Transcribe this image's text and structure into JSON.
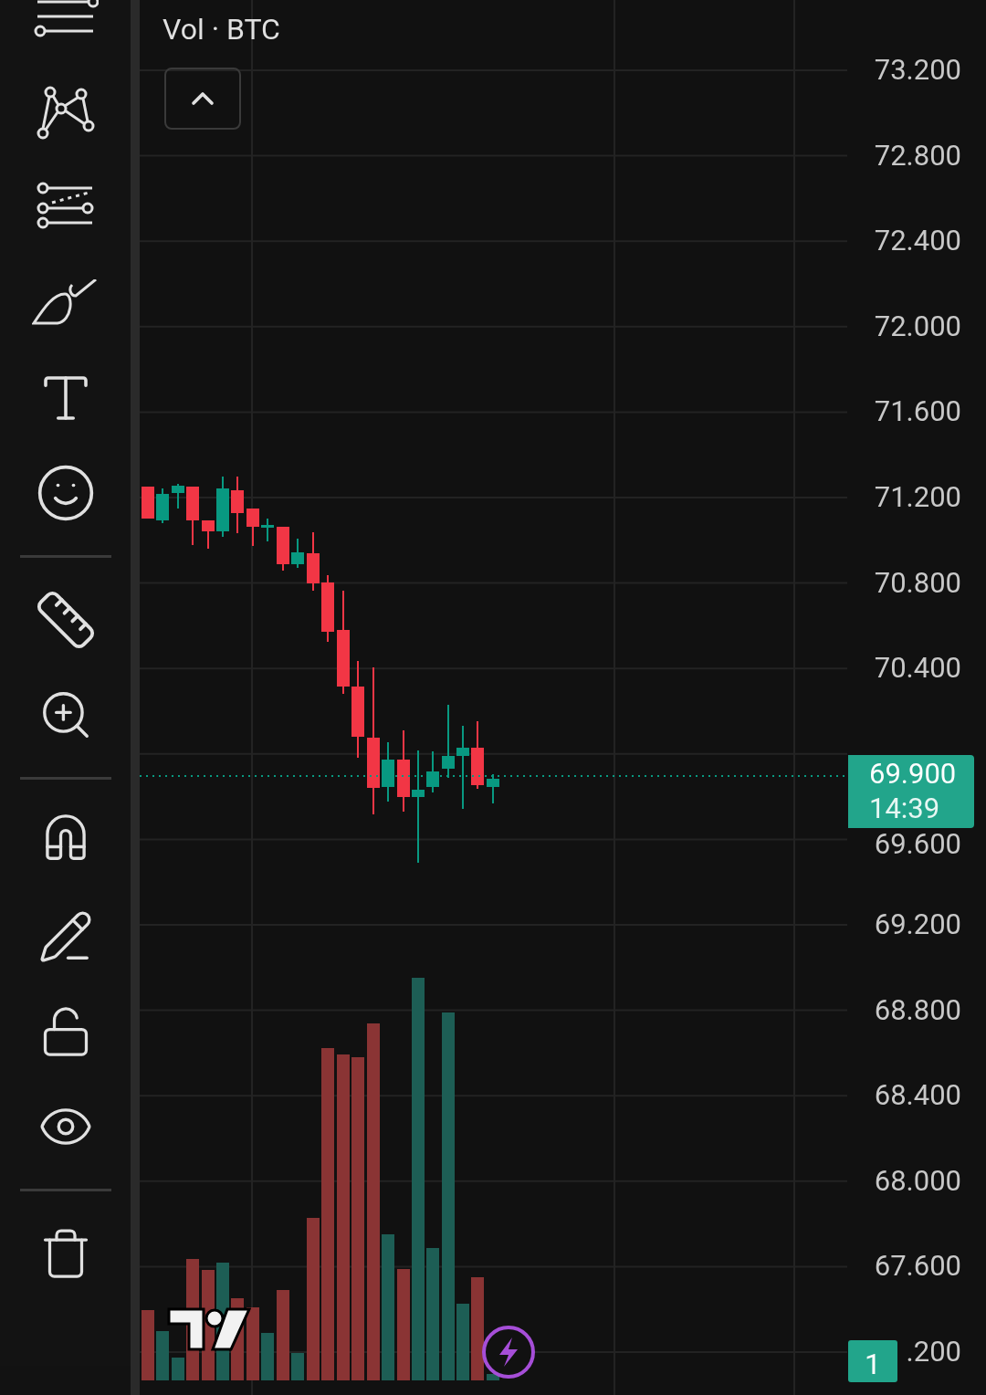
{
  "legend": {
    "title": "Vol · BTC"
  },
  "price_axis": {
    "labels": [
      "73.200",
      "72.800",
      "72.400",
      "72.000",
      "71.600",
      "71.200",
      "70.800",
      "70.400",
      "69.600",
      "69.200",
      "68.800",
      "68.400",
      "68.000",
      "67.600",
      ".200"
    ]
  },
  "last_price": {
    "price": "69.900",
    "countdown": "14:39"
  },
  "badge": {
    "count": "1"
  }
}
